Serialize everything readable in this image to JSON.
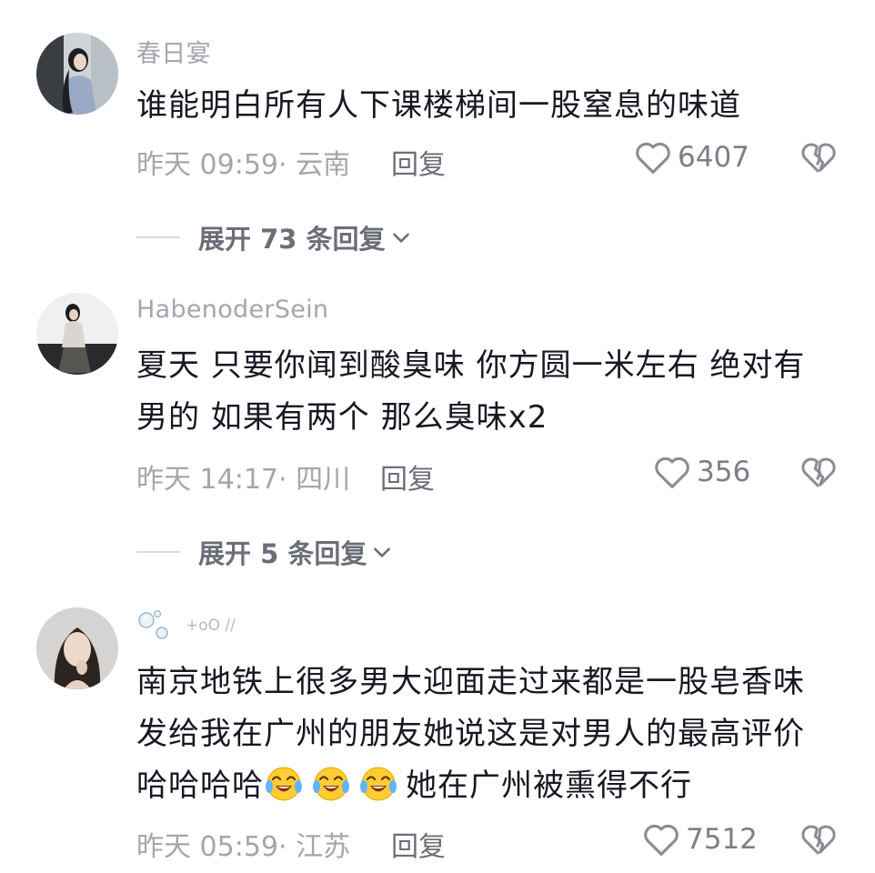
{
  "comments": [
    {
      "username": "春日宴",
      "lines": [
        "谁能明白所有人下课楼梯间一股窒息的味道"
      ],
      "meta": "昨天 09:59· 云南",
      "reply_label": "回复",
      "likes": "6407",
      "expand_label": "展开 73 条回复"
    },
    {
      "username": "HabenoderSein",
      "lines": [
        "夏天 只要你闻到酸臭味 你方圆一米左右 绝对有",
        "男的 如果有两个 那么臭味x2"
      ],
      "meta": "昨天 14:17· 四川",
      "reply_label": "回复",
      "likes": "356",
      "expand_label": "展开 5 条回复"
    },
    {
      "username_decor": "+oO //",
      "lines": [
        "南京地铁上很多男大迎面走过来都是一股皂香味",
        "发给我在广州的朋友她说这是对男人的最高评价",
        "哈哈哈哈",
        "她在广州被熏得不行"
      ],
      "emojis": [
        "crying-laugh-emoji",
        "crying-laugh-emoji",
        "crying-laugh-emoji"
      ],
      "meta": "昨天 05:59· 江苏",
      "reply_label": "回复",
      "likes": "7512"
    }
  ],
  "icons": {
    "like": "heart-outline-icon",
    "dislike": "broken-heart-icon",
    "expand": "chevron-down-icon"
  },
  "colors": {
    "text_primary": "#161823",
    "text_secondary": "#a3a6ad",
    "text_action": "#6b6e78"
  }
}
